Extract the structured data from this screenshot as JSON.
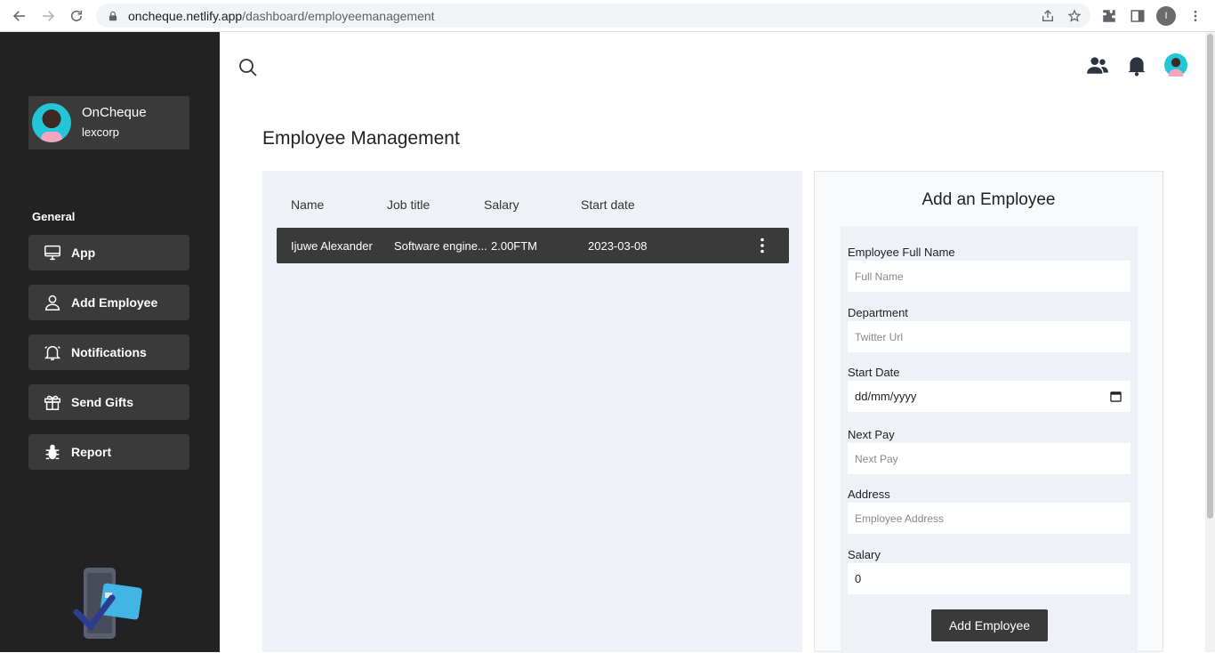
{
  "browser": {
    "url_host": "oncheque.netlify.app",
    "url_path": "/dashboard/employeemanagement",
    "profile_initial": "I"
  },
  "sidebar": {
    "user_name": "OnCheque",
    "user_org": "lexcorp",
    "section_label": "General",
    "items": [
      {
        "label": "App",
        "icon": "monitor-icon"
      },
      {
        "label": "Add Employee",
        "icon": "user-icon"
      },
      {
        "label": "Notifications",
        "icon": "bell-icon"
      },
      {
        "label": "Send Gifts",
        "icon": "gift-icon"
      },
      {
        "label": "Report",
        "icon": "bug-icon"
      }
    ]
  },
  "header": {
    "page_title": "Employee Management"
  },
  "table": {
    "columns": [
      "Name",
      "Job title",
      "Salary",
      "Start date"
    ],
    "rows": [
      {
        "name": "Ijuwe Alexander",
        "job_title": "Software engine...",
        "salary": "2.00FTM",
        "start_date": "2023-03-08"
      }
    ]
  },
  "form": {
    "title": "Add an Employee",
    "fields": [
      {
        "label": "Employee Full Name",
        "placeholder": "Full Name",
        "value": ""
      },
      {
        "label": "Department",
        "placeholder": "Twitter Url",
        "value": ""
      },
      {
        "label": "Start Date",
        "placeholder": "dd/mm/yyyy",
        "value": ""
      },
      {
        "label": "Next Pay",
        "placeholder": "Next Pay",
        "value": ""
      },
      {
        "label": "Address",
        "placeholder": "Employee Address",
        "value": ""
      },
      {
        "label": "Salary",
        "placeholder": "",
        "value": "0"
      }
    ],
    "submit_label": "Add Employee"
  },
  "colors": {
    "sidebar_bg": "#222222",
    "card_bg": "#3a3a3a",
    "panel_bg": "#eef1f5",
    "accent_teal": "#23c6d6"
  }
}
